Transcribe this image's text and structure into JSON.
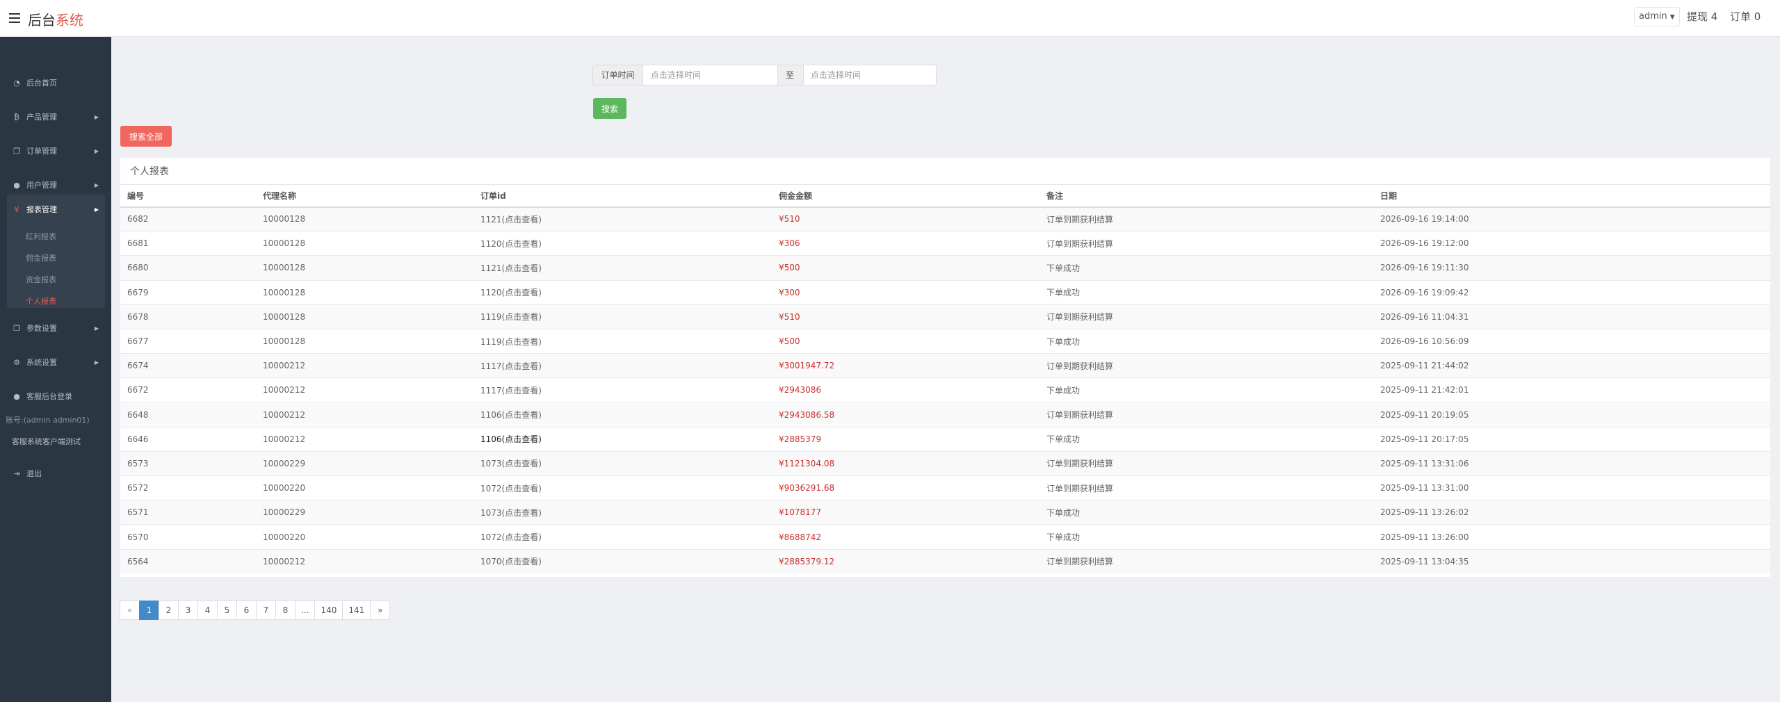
{
  "header": {
    "brand_main": "后台",
    "brand_accent": "系统",
    "user": "admin",
    "withdraw": "提现 4",
    "orders": "订单 0"
  },
  "sidebar": {
    "items": [
      {
        "label": "后台首页"
      },
      {
        "label": "产品管理"
      },
      {
        "label": "订单管理"
      },
      {
        "label": "用户管理"
      },
      {
        "label": "报表管理"
      },
      {
        "label": "参数设置"
      },
      {
        "label": "系统设置"
      }
    ],
    "sub_items": [
      {
        "label": "红利报表"
      },
      {
        "label": "佣金报表"
      },
      {
        "label": "资金报表"
      },
      {
        "label": "个人报表"
      }
    ],
    "support_login": "客服后台登录",
    "account": "账号:(admin admin01)",
    "support_test": "客服系统客户端测试",
    "logout": "退出"
  },
  "filter": {
    "label": "订单时间",
    "start_placeholder": "点击选择时间",
    "to": "至",
    "end_placeholder": "点击选择时间",
    "search": "搜索",
    "search_all": "搜索全部"
  },
  "report": {
    "title": "个人报表",
    "columns": [
      "编号",
      "代理名称",
      "订单id",
      "佣金金额",
      "备注",
      "日期"
    ],
    "rows": [
      {
        "id": "6682",
        "agent": "10000128",
        "order": "1121(点击查看)",
        "amount": "¥510",
        "note": "订单到期获利结算",
        "date": "2026-09-16 19:14:00"
      },
      {
        "id": "6681",
        "agent": "10000128",
        "order": "1120(点击查看)",
        "amount": "¥306",
        "note": "订单到期获利结算",
        "date": "2026-09-16 19:12:00"
      },
      {
        "id": "6680",
        "agent": "10000128",
        "order": "1121(点击查看)",
        "amount": "¥500",
        "note": "下单成功",
        "date": "2026-09-16 19:11:30"
      },
      {
        "id": "6679",
        "agent": "10000128",
        "order": "1120(点击查看)",
        "amount": "¥300",
        "note": "下单成功",
        "date": "2026-09-16 19:09:42"
      },
      {
        "id": "6678",
        "agent": "10000128",
        "order": "1119(点击查看)",
        "amount": "¥510",
        "note": "订单到期获利结算",
        "date": "2026-09-16 11:04:31"
      },
      {
        "id": "6677",
        "agent": "10000128",
        "order": "1119(点击查看)",
        "amount": "¥500",
        "note": "下单成功",
        "date": "2026-09-16 10:56:09"
      },
      {
        "id": "6674",
        "agent": "10000212",
        "order": "1117(点击查看)",
        "amount": "¥3001947.72",
        "note": "订单到期获利结算",
        "date": "2025-09-11 21:44:02"
      },
      {
        "id": "6672",
        "agent": "10000212",
        "order": "1117(点击查看)",
        "amount": "¥2943086",
        "note": "下单成功",
        "date": "2025-09-11 21:42:01"
      },
      {
        "id": "6648",
        "agent": "10000212",
        "order": "1106(点击查看)",
        "amount": "¥2943086.58",
        "note": "订单到期获利结算",
        "date": "2025-09-11 20:19:05"
      },
      {
        "id": "6646",
        "agent": "10000212",
        "order": "1106(点击查看)",
        "amount": "¥2885379",
        "note": "下单成功",
        "date": "2025-09-11 20:17:05"
      },
      {
        "id": "6573",
        "agent": "10000229",
        "order": "1073(点击查看)",
        "amount": "¥1121304.08",
        "note": "订单到期获利结算",
        "date": "2025-09-11 13:31:06"
      },
      {
        "id": "6572",
        "agent": "10000220",
        "order": "1072(点击查看)",
        "amount": "¥9036291.68",
        "note": "订单到期获利结算",
        "date": "2025-09-11 13:31:00"
      },
      {
        "id": "6571",
        "agent": "10000229",
        "order": "1073(点击查看)",
        "amount": "¥1078177",
        "note": "下单成功",
        "date": "2025-09-11 13:26:02"
      },
      {
        "id": "6570",
        "agent": "10000220",
        "order": "1072(点击查看)",
        "amount": "¥8688742",
        "note": "下单成功",
        "date": "2025-09-11 13:26:00"
      },
      {
        "id": "6564",
        "agent": "10000212",
        "order": "1070(点击查看)",
        "amount": "¥2885379.12",
        "note": "订单到期获利结算",
        "date": "2025-09-11 13:04:35"
      }
    ]
  },
  "pagination": {
    "prev": "«",
    "pages": [
      "1",
      "2",
      "3",
      "4",
      "5",
      "6",
      "7",
      "8",
      "...",
      "140",
      "141"
    ],
    "current": "1",
    "next": "»"
  }
}
